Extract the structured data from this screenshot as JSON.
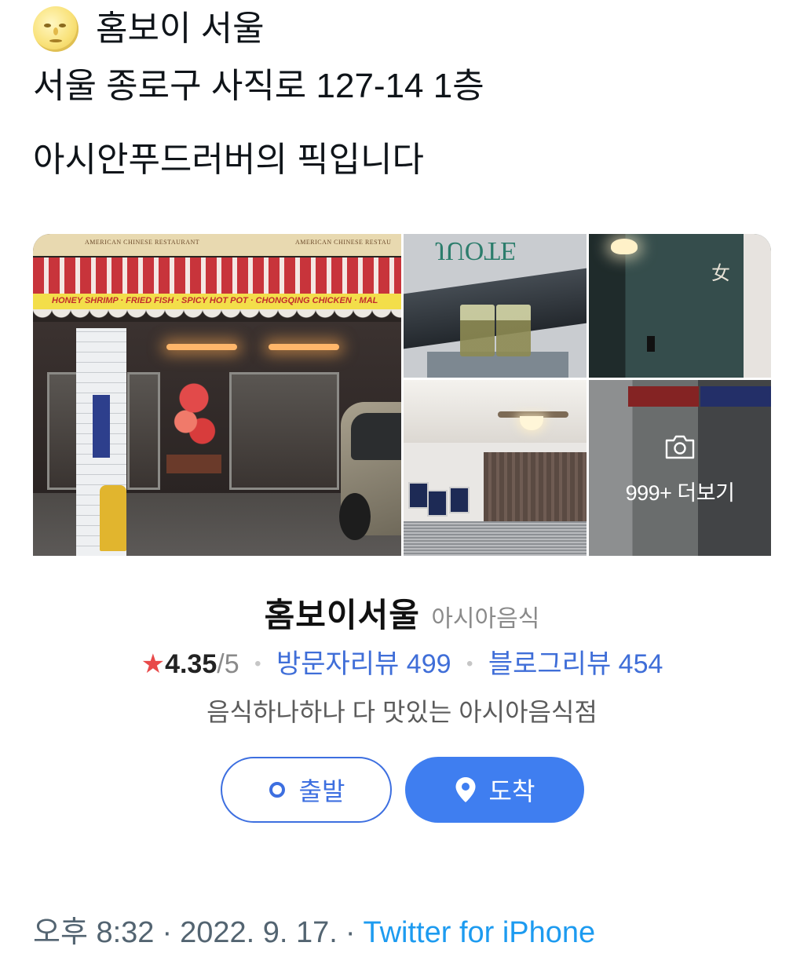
{
  "tweet": {
    "line1": "홈보이 서울",
    "line2": "서울 종로구 사직로 127-14 1층",
    "line3": "아시안푸드러버의 픽입니다"
  },
  "storefront": {
    "sign_left": "AMERICAN CHINESE RESTAURANT",
    "sign_right": "AMERICAN CHINESE RESTAU",
    "banner": "HONEY SHRIMP · FRIED FISH · SPICY HOT POT · CHONGQING CHICKEN · MAL"
  },
  "photos": {
    "more_label": "999+ 더보기"
  },
  "place": {
    "name": "홈보이서울",
    "category": "아시아음식",
    "rating": "4.35",
    "rating_max": "/5",
    "visitor_reviews": "방문자리뷰 499",
    "blog_reviews": "블로그리뷰 454",
    "description": "음식하나하나 다 맛있는 아시아음식점",
    "start_label": "출발",
    "arrive_label": "도착"
  },
  "footer": {
    "time": "오후 8:32",
    "date": "2022. 9. 17.",
    "separator": "·",
    "source": "Twitter for iPhone"
  },
  "colors": {
    "accent_blue": "#3f7ef0",
    "link_blue": "#3f6ed8",
    "star_red": "#e84a4a",
    "twitter_blue": "#1d9bf0"
  },
  "icons": [
    "full-moon-face-icon",
    "star-icon",
    "camera-icon",
    "origin-dot-icon",
    "location-pin-icon"
  ]
}
